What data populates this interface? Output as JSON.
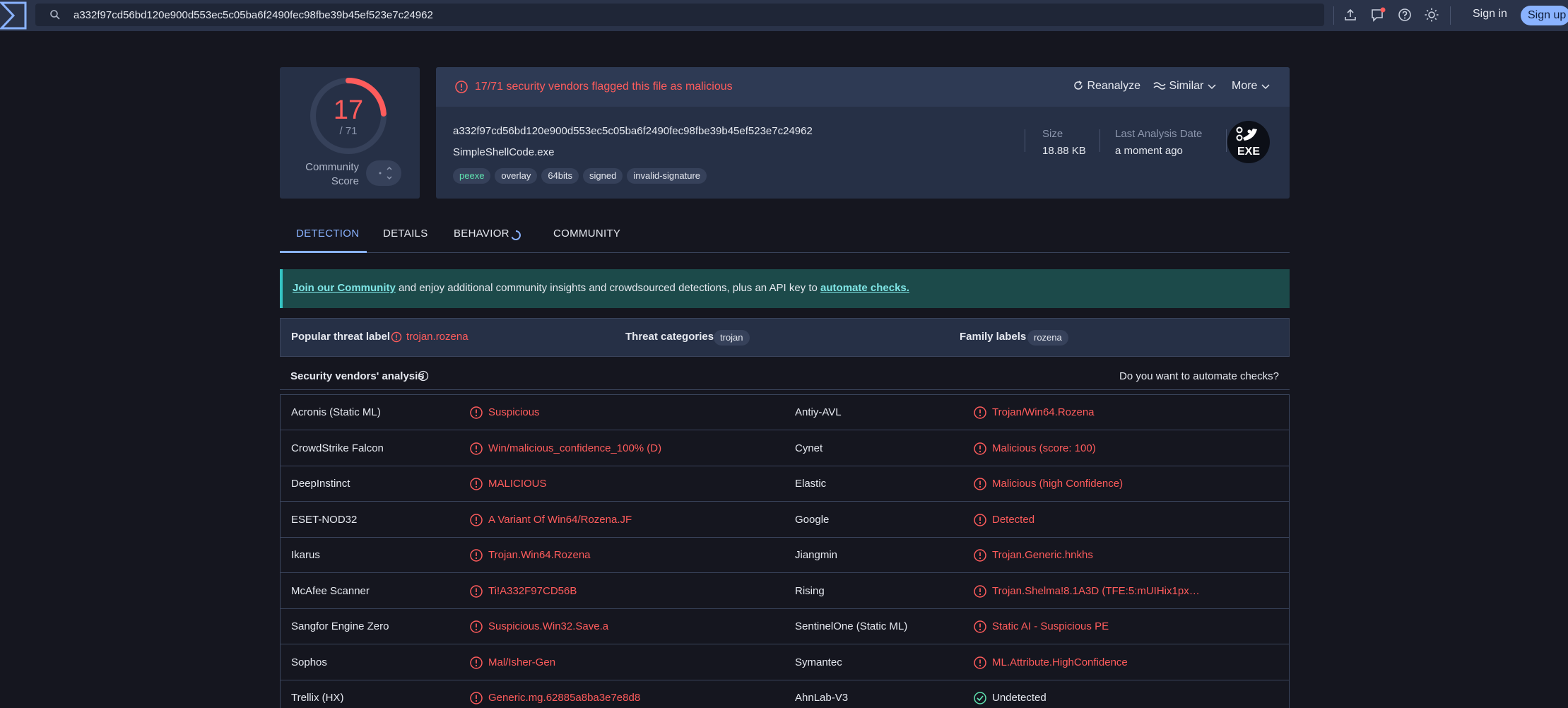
{
  "search": {
    "value": "a332f97cd56bd120e900d553ec5c05ba6f2490fec98fbe39b45ef523e7c24962"
  },
  "header": {
    "sign_in": "Sign in",
    "sign_up": "Sign up"
  },
  "score": {
    "value": "17",
    "total": "/ 71",
    "detected": 17,
    "of": 71,
    "community_label_1": "Community",
    "community_label_2": "Score"
  },
  "alert": {
    "text": "17/71 security vendors flagged this file as malicious"
  },
  "actions": {
    "reanalyze": "Reanalyze",
    "similar": "Similar",
    "more": "More"
  },
  "file": {
    "hash": "a332f97cd56bd120e900d553ec5c05ba6f2490fec98fbe39b45ef523e7c24962",
    "name": "SimpleShellCode.exe",
    "tags": [
      "peexe",
      "overlay",
      "64bits",
      "signed",
      "invalid-signature"
    ],
    "size_label": "Size",
    "size_value": "18.88 KB",
    "date_label": "Last Analysis Date",
    "date_value": "a moment ago",
    "type_badge": "EXE"
  },
  "tabs": [
    "DETECTION",
    "DETAILS",
    "BEHAVIOR",
    "COMMUNITY"
  ],
  "banner": {
    "link1": "Join our Community",
    "middle": " and enjoy additional community insights and crowdsourced detections, plus an API key to ",
    "link2": "automate checks."
  },
  "threat": {
    "popular_label": "Popular threat label",
    "popular_value": "trojan.rozena",
    "categories_label": "Threat categories",
    "categories_value": "trojan",
    "family_label": "Family labels",
    "family_value": "rozena"
  },
  "vendors_header": {
    "title": "Security vendors' analysis",
    "right": "Do you want to automate checks?"
  },
  "vendors": [
    {
      "l_name": "Acronis (Static ML)",
      "l_result": "Suspicious",
      "r_name": "Antiy-AVL",
      "r_result": "Trojan/Win64.Rozena"
    },
    {
      "l_name": "CrowdStrike Falcon",
      "l_result": "Win/malicious_confidence_100% (D)",
      "r_name": "Cynet",
      "r_result": "Malicious (score: 100)"
    },
    {
      "l_name": "DeepInstinct",
      "l_result": "MALICIOUS",
      "r_name": "Elastic",
      "r_result": "Malicious (high Confidence)"
    },
    {
      "l_name": "ESET-NOD32",
      "l_result": "A Variant Of Win64/Rozena.JF",
      "r_name": "Google",
      "r_result": "Detected"
    },
    {
      "l_name": "Ikarus",
      "l_result": "Trojan.Win64.Rozena",
      "r_name": "Jiangmin",
      "r_result": "Trojan.Generic.hnkhs"
    },
    {
      "l_name": "McAfee Scanner",
      "l_result": "Ti!A332F97CD56B",
      "r_name": "Rising",
      "r_result": "Trojan.Shelma!8.1A3D (TFE:5:mUIHix1px…"
    },
    {
      "l_name": "Sangfor Engine Zero",
      "l_result": "Suspicious.Win32.Save.a",
      "r_name": "SentinelOne (Static ML)",
      "r_result": "Static AI - Suspicious PE"
    },
    {
      "l_name": "Sophos",
      "l_result": "Mal/Isher-Gen",
      "r_name": "Symantec",
      "r_result": "ML.Attribute.HighConfidence"
    },
    {
      "l_name": "Trellix (HX)",
      "l_result": "Generic.mg.62885a8ba3e7e8d8",
      "r_name": "AhnLab-V3",
      "r_result": "Undetected",
      "r_ok": true
    }
  ],
  "colors": {
    "malicious": "#ff5c5c",
    "accent": "#8ab3ff",
    "clean": "#5fe3b0"
  }
}
